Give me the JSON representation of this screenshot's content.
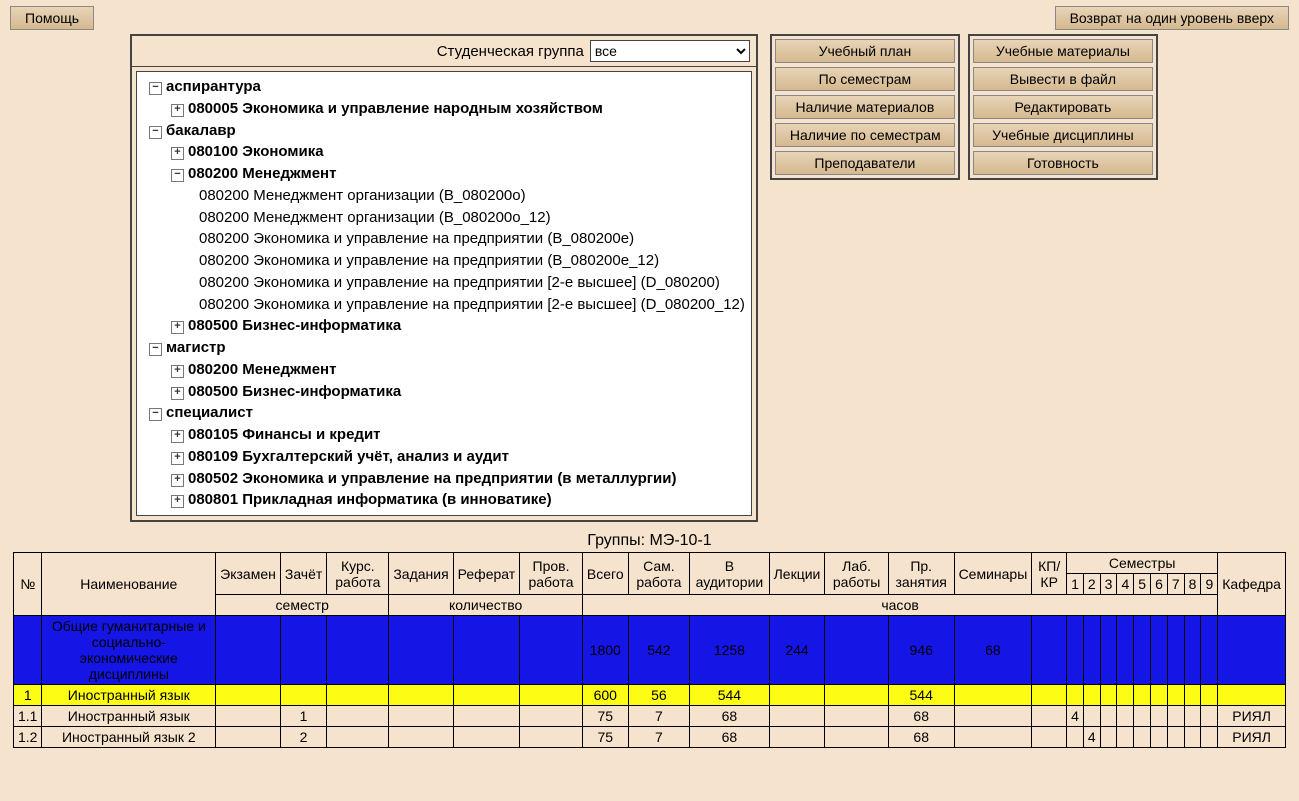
{
  "top": {
    "help": "Помощь",
    "back": "Возврат на один уровень вверх"
  },
  "filter": {
    "label": "Студенческая группа",
    "selected": "все"
  },
  "tree": {
    "n0": "аспирантура",
    "n0_0": "080005 Экономика и управление народным хозяйством",
    "n1": "бакалавр",
    "n1_0": "080100 Экономика",
    "n1_1": "080200 Менеджмент",
    "n1_1_0": "080200 Менеджмент организации (B_080200о)",
    "n1_1_1": "080200 Менеджмент организации (B_080200о_12)",
    "n1_1_2": "080200 Экономика и управление на предприятии (B_080200е)",
    "n1_1_3": "080200 Экономика и управление на предприятии (B_080200е_12)",
    "n1_1_4": "080200 Экономика и управление на предприятии [2-е высшее] (D_080200)",
    "n1_1_5": "080200 Экономика и управление на предприятии [2-е высшее] (D_080200_12)",
    "n1_2": "080500 Бизнес-информатика",
    "n2": "магистр",
    "n2_0": "080200 Менеджмент",
    "n2_1": "080500 Бизнес-информатика",
    "n3": "специалист",
    "n3_0": "080105 Финансы и кредит",
    "n3_1": "080109 Бухгалтерский учёт, анализ и аудит",
    "n3_2": "080502 Экономика и управление на предприятии (в металлургии)",
    "n3_3": "080801 Прикладная информатика (в инноватике)"
  },
  "buttons": {
    "left": {
      "b0": "Учебный план",
      "b1": "По семестрам",
      "b2": "Наличие материалов",
      "b3": "Наличие по семестрам",
      "b4": "Преподаватели"
    },
    "right": {
      "b0": "Учебные материалы",
      "b1": "Вывести в файл",
      "b2": "Редактировать",
      "b3": "Учебные дисциплины",
      "b4": "Готовность"
    }
  },
  "groups_label": "Группы: МЭ-10-1",
  "grid": {
    "h_num": "№",
    "h_name": "Наименование",
    "h_exam": "Экзамен",
    "h_zachet": "Зачёт",
    "h_kurs": "Курс. работа",
    "h_zadan": "Задания",
    "h_ref": "Реферат",
    "h_prov": "Пров. работа",
    "h_vsego": "Всего",
    "h_sam": "Сам. работа",
    "h_vaud": "В аудитории",
    "h_lek": "Лекции",
    "h_lab": "Лаб. работы",
    "h_pr": "Пр. занятия",
    "h_sem": "Семинары",
    "h_kpkr": "КП/КР",
    "h_semesters": "Семестры",
    "h_s1": "1",
    "h_s2": "2",
    "h_s3": "3",
    "h_s4": "4",
    "h_s5": "5",
    "h_s6": "6",
    "h_s7": "7",
    "h_s8": "8",
    "h_s9": "9",
    "h_kaf": "Кафедра",
    "h_semester": "семестр",
    "h_kolich": "количество",
    "h_chasov": "часов",
    "section": {
      "name": "Общие гуманитарные и социально-экономические дисциплины",
      "vsego": "1800",
      "sam": "542",
      "vaud": "1258",
      "lek": "244",
      "pr": "946",
      "sem": "68"
    },
    "r1": {
      "num": "1",
      "name": "Иностранный язык",
      "vsego": "600",
      "sam": "56",
      "vaud": "544",
      "pr": "544"
    },
    "r11": {
      "num": "1.1",
      "name": "Иностранный язык",
      "zachet": "1",
      "vsego": "75",
      "sam": "7",
      "vaud": "68",
      "pr": "68",
      "s1": "4",
      "kaf": "РИЯЛ"
    },
    "r12": {
      "num": "1.2",
      "name": "Иностранный язык 2",
      "zachet": "2",
      "vsego": "75",
      "sam": "7",
      "vaud": "68",
      "pr": "68",
      "s2": "4",
      "kaf": "РИЯЛ"
    }
  }
}
